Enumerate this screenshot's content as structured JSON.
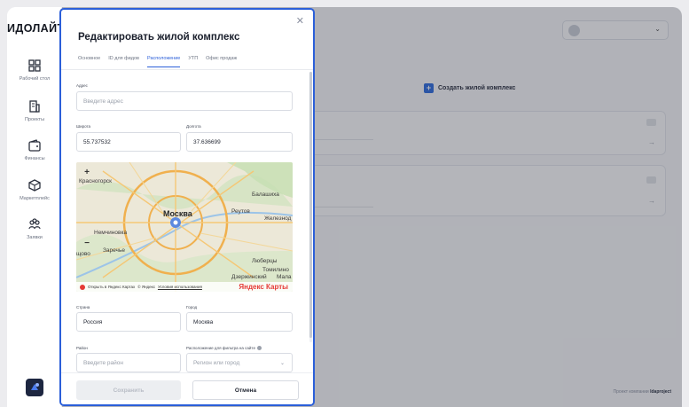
{
  "app": {
    "logo": "ИДОЛАЙТ",
    "nav": [
      {
        "label": "Рабочий стол",
        "icon": "dashboard-icon"
      },
      {
        "label": "Проекты",
        "icon": "building-icon"
      },
      {
        "label": "Финансы",
        "icon": "wallet-icon"
      },
      {
        "label": "Маркетплейс",
        "icon": "box-icon"
      },
      {
        "label": "Заявки",
        "icon": "users-icon"
      }
    ]
  },
  "main": {
    "create_button": "Создать жилой комплекс",
    "footer_prefix": "Проект компании",
    "footer_brand": "Idaproject"
  },
  "modal": {
    "title": "Редактировать жилой комплекс",
    "tabs": [
      "Основное",
      "ID для фидов",
      "Расположение",
      "УТП",
      "Офис продаж"
    ],
    "active_tab": "Расположение",
    "address": {
      "label": "Адрес",
      "placeholder": "Введите адрес"
    },
    "latitude": {
      "label": "Широта",
      "value": "55.737532"
    },
    "longitude": {
      "label": "Долгота",
      "value": "37.636699"
    },
    "map": {
      "city": "Москва",
      "places": [
        "Красногорск",
        "Балашиха",
        "Реутов",
        "Железнод",
        "Немчиновка",
        "Заречье",
        "щово",
        "Люберцы",
        "Томилино",
        "Дзержинский",
        "Мала"
      ],
      "open_link": "Открыть в Яндекс Картах",
      "copyright": "© Яндекс",
      "terms": "Условия использования",
      "brand": "Яндекс Карты"
    },
    "country": {
      "label": "Страна",
      "value": "Россия"
    },
    "city": {
      "label": "Город",
      "value": "Москва"
    },
    "district": {
      "label": "Район",
      "placeholder": "Введите район"
    },
    "site_location": {
      "label": "Расположение для фильтра на сайте",
      "placeholder": "Регион или город"
    },
    "save_button": "Сохранить",
    "cancel_button": "Отмена"
  },
  "colors": {
    "accent": "#2b5fd9",
    "overlay": "rgba(40,44,56,0.35)"
  }
}
